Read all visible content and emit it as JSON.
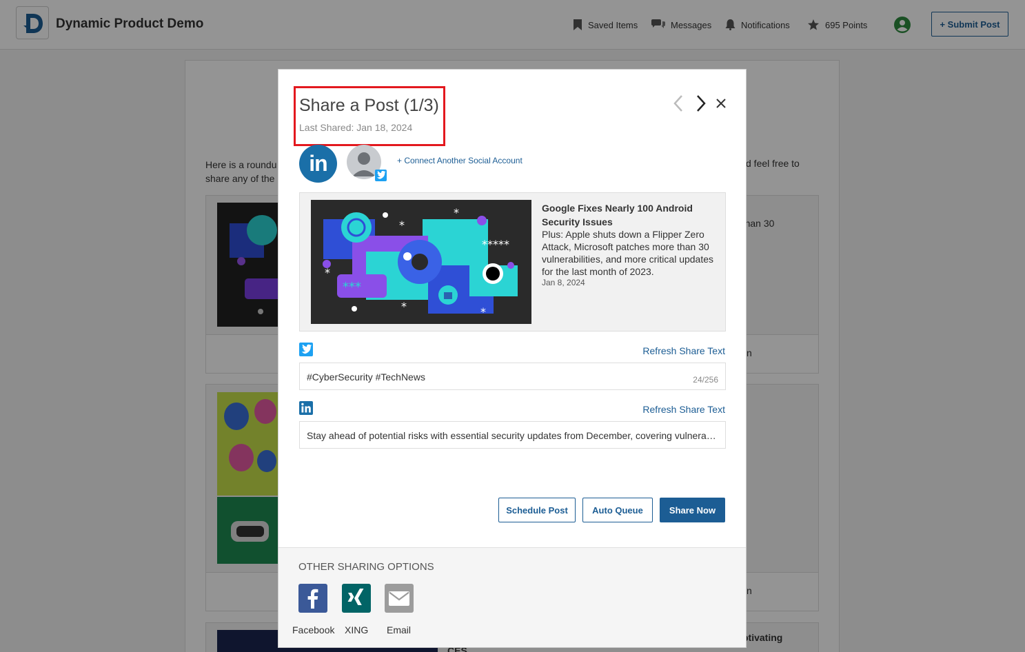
{
  "header": {
    "app_title": "Dynamic Product Demo",
    "nav": {
      "saved": "Saved Items",
      "messages": "Messages",
      "notifications": "Notifications",
      "points": "695 Points"
    },
    "submit_label": "+ Submit Post"
  },
  "background": {
    "intro_left": "Here is a roundu share any of the",
    "intro_right": "d feel free to",
    "post1_side": "e than 30",
    "post1_foot": "n",
    "post2_foot": "n",
    "post3_side": "ptivating",
    "post3_cut": "CES"
  },
  "modal": {
    "title": "Share a Post (1/3)",
    "last_shared": "Last Shared: Jan 18, 2024",
    "connect_label": "+ Connect Another Social Account",
    "preview": {
      "title": "Google Fixes Nearly 100 Android Security Issues",
      "description": "Plus: Apple shuts down a Flipper Zero Attack, Microsoft patches more than 30 vulnerabilities, and more critical updates for the last month of 2023.",
      "date": "Jan 8, 2024"
    },
    "twitter": {
      "refresh_label": "Refresh Share Text",
      "text": "#CyberSecurity #TechNews",
      "count": "24/256"
    },
    "linkedin": {
      "refresh_label": "Refresh Share Text",
      "text": "Stay ahead of potential risks with essential security updates from December, covering vulnerabilities across Android, Apple and Microsoft."
    },
    "buttons": {
      "schedule": "Schedule Post",
      "auto_queue": "Auto Queue",
      "share_now": "Share Now"
    },
    "other": {
      "title": "OTHER SHARING OPTIONS",
      "facebook": "Facebook",
      "xing": "XING",
      "email": "Email"
    }
  },
  "colors": {
    "brand_blue": "#1c5d94",
    "linkedin": "#1a6fa8",
    "twitter": "#1da1f2",
    "facebook": "#3b5998",
    "xing": "#026466",
    "highlight": "#e3181e"
  }
}
